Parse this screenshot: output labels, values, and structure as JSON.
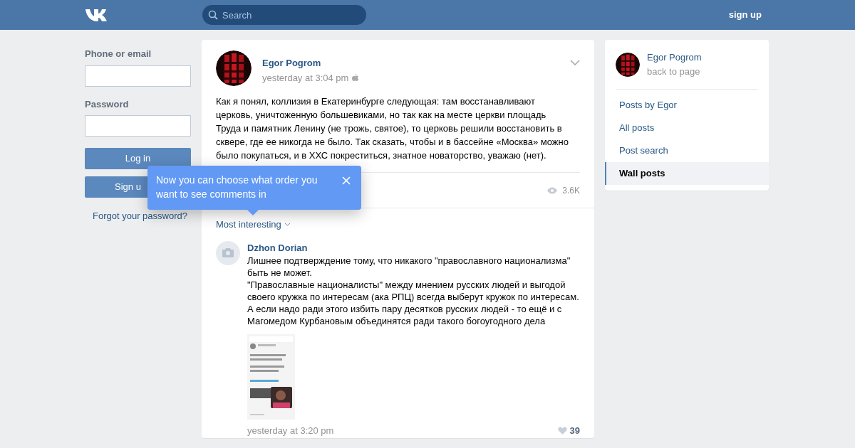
{
  "header": {
    "search": {
      "placeholder": "Search"
    },
    "signup_link": "sign up"
  },
  "login": {
    "fields": [
      {
        "label": "Phone or email"
      },
      {
        "label": "Password"
      }
    ],
    "login_button": "Log in",
    "signup_button": "Sign u",
    "forgot_link": "Forgot your password?"
  },
  "post": {
    "author": "Egor Pogrom",
    "time": "yesterday at 3:04 pm",
    "text": "Как я понял, коллизия в Екатеринбурге следующая: там восстанавливают церковь, уничтоженную большевиками, но так как на месте церкви площадь Труда и памятник Ленину (не трожь, святое), то церковь решили восстановить в сквере, где ее никогда не было. Так сказать, чтобы и в бассейне «Москва» можно было покупаться, и в ХХС покреститься, знатное новаторство, уважаю (нет).",
    "views": "3.6K"
  },
  "comments_sort": "Most interesting",
  "tooltip": {
    "text": "Now you can choose what order you want to see comments in"
  },
  "comments": [
    {
      "author": "Dzhon Dorian",
      "lines": [
        "Лишнее подтверждение тому, что никакого \"православного национализма\" быть не может.",
        "\"Православные националисты\" между мнением русских людей и выгодой своего кружка по интересам (ака РПЦ) всегда выберут кружок по интересам.",
        "А если надо ради этого избить пару десятков русских людей - то ещё и с Магомедом Курбановым объединятся ради такого богоугодного дела"
      ],
      "attachment": {
        "kind": "picture"
      },
      "time": "yesterday at 3:20 pm",
      "likes": "39"
    }
  ],
  "sidebar": {
    "profile": {
      "name": "Egor Pogrom",
      "subtitle": "back to page"
    },
    "items": [
      {
        "label": "Posts by Egor",
        "selected": false
      },
      {
        "label": "All posts",
        "selected": false
      },
      {
        "label": "Post search",
        "selected": false
      },
      {
        "label": "Wall posts",
        "selected": true
      }
    ]
  }
}
